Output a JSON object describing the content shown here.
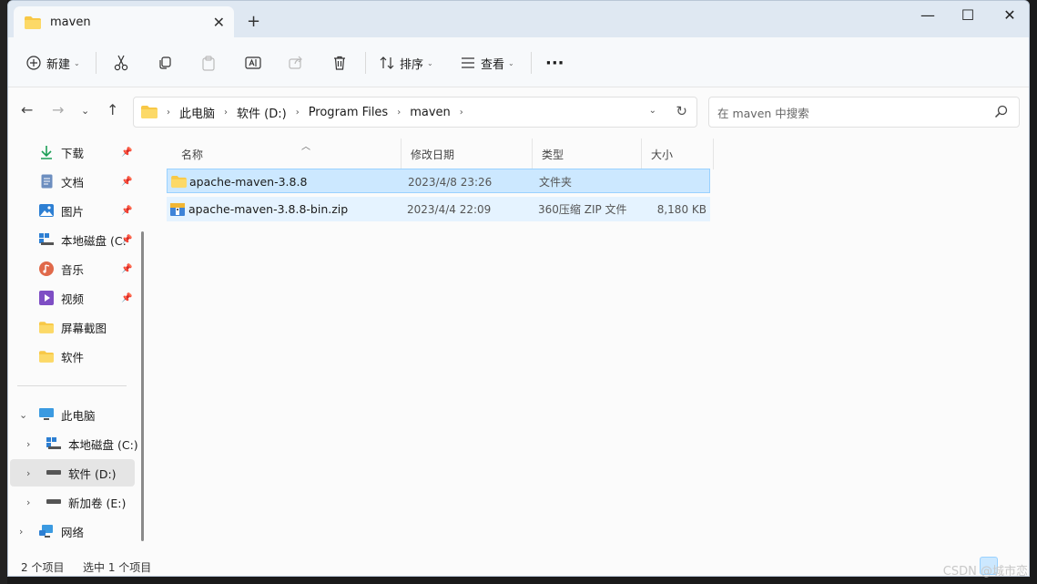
{
  "window": {
    "tab_title": "maven",
    "new_tab": "+",
    "controls": {
      "minimize": "—",
      "maximize": "☐",
      "close": "✕"
    }
  },
  "toolbar": {
    "new_label": "新建",
    "sort_label": "排序",
    "view_label": "查看",
    "more": "···"
  },
  "nav": {
    "breadcrumbs": [
      "此电脑",
      "软件 (D:)",
      "Program Files",
      "maven"
    ],
    "search_placeholder": "在 maven 中搜索"
  },
  "sidebar": {
    "quick_access": [
      {
        "label": "下载",
        "icon": "download-icon",
        "pinned": true
      },
      {
        "label": "文档",
        "icon": "document-icon",
        "pinned": true
      },
      {
        "label": "图片",
        "icon": "picture-icon",
        "pinned": true
      },
      {
        "label": "本地磁盘 (C:",
        "icon": "drive-icon",
        "pinned": true
      },
      {
        "label": "音乐",
        "icon": "music-icon",
        "pinned": true
      },
      {
        "label": "视频",
        "icon": "video-icon",
        "pinned": true
      },
      {
        "label": "屏幕截图",
        "icon": "folder-icon",
        "pinned": false
      },
      {
        "label": "软件",
        "icon": "folder-icon",
        "pinned": false
      }
    ],
    "this_pc": "此电脑",
    "drives": [
      {
        "label": "本地磁盘 (C:)",
        "selected": false
      },
      {
        "label": "软件 (D:)",
        "selected": true
      },
      {
        "label": "新加卷 (E:)",
        "selected": false
      }
    ],
    "network": "网络"
  },
  "columns": {
    "name": "名称",
    "date": "修改日期",
    "type": "类型",
    "size": "大小"
  },
  "files": [
    {
      "name": "apache-maven-3.8.8",
      "date": "2023/4/8 23:26",
      "type": "文件夹",
      "size": "",
      "icon": "folder-icon",
      "state": "selected"
    },
    {
      "name": "apache-maven-3.8.8-bin.zip",
      "date": "2023/4/4 22:09",
      "type": "360压缩 ZIP 文件",
      "size": "8,180 KB",
      "icon": "zip-icon",
      "state": "hover"
    }
  ],
  "status": {
    "count": "2 个项目",
    "selected": "选中 1 个项目"
  },
  "watermark": "CSDN @城市恋",
  "colors": {
    "accent": "#0067c0",
    "selection": "#cce8ff",
    "titlebar": "#dfe8f2",
    "folder": "#f8c846"
  }
}
